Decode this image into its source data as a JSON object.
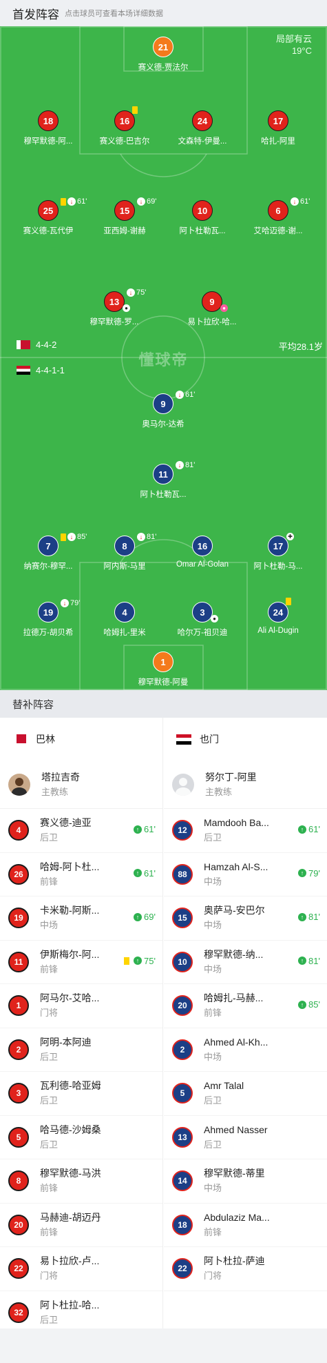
{
  "header": {
    "title": "首发阵容",
    "hint": "点击球员可查看本场详细数据"
  },
  "weather": {
    "condition": "局部有云",
    "temp": "19°C"
  },
  "watermark": "懂球帝",
  "home": {
    "formation": "4-4-2",
    "avg_age": "平均28.1岁",
    "players": [
      {
        "num": "21",
        "name": "赛义德-贾法尔",
        "gk": true
      },
      {
        "num": "18",
        "name": "穆罕默德-阿..."
      },
      {
        "num": "16",
        "name": "赛义德-巴吉尔",
        "card": true
      },
      {
        "num": "24",
        "name": "文森特-伊曼..."
      },
      {
        "num": "17",
        "name": "哈扎-阿里"
      },
      {
        "num": "25",
        "name": "赛义德-瓦代伊",
        "card": true,
        "subout": true,
        "minute": "61'"
      },
      {
        "num": "15",
        "name": "亚西姆-谢赫",
        "subout": true,
        "minute": "69'"
      },
      {
        "num": "10",
        "name": "阿卜杜勒瓦..."
      },
      {
        "num": "6",
        "name": "艾哈迈德-谢...",
        "subout": true,
        "minute": "61'"
      },
      {
        "num": "13",
        "name": "穆罕默德-罗...",
        "subout": true,
        "minute": "75'",
        "goal": true
      },
      {
        "num": "9",
        "name": "易卜拉欣-哈...",
        "owngoal": true
      }
    ]
  },
  "away": {
    "formation": "4-4-1-1",
    "players": [
      {
        "num": "9",
        "name": "奥马尔-达希",
        "subout": true,
        "minute": "61'"
      },
      {
        "num": "11",
        "name": "阿卜杜勒瓦...",
        "subout": true,
        "minute": "81'"
      },
      {
        "num": "7",
        "name": "纳赛尔-穆罕...",
        "card": true,
        "subout": true,
        "minute": "85'"
      },
      {
        "num": "8",
        "name": "阿内斯-马里",
        "subout": true,
        "minute": "81'"
      },
      {
        "num": "16",
        "name": "Omar Al-Golan"
      },
      {
        "num": "17",
        "name": "阿卜杜勒-马...",
        "injury": true
      },
      {
        "num": "19",
        "name": "拉德万-胡贝希",
        "subout": true,
        "minute": "79'"
      },
      {
        "num": "4",
        "name": "哈姆扎-里米"
      },
      {
        "num": "3",
        "name": "哈尔万-祖贝迪",
        "goal": true
      },
      {
        "num": "24",
        "name": "Ali Al-Dugin",
        "card": true
      },
      {
        "num": "1",
        "name": "穆罕默德-阿曼",
        "gk": true
      }
    ]
  },
  "subs_title": "替补阵容",
  "bench": {
    "left": {
      "team": "巴林",
      "coach": {
        "name": "塔拉吉奇",
        "role": "主教练"
      },
      "players": [
        {
          "num": "4",
          "name": "赛义德-迪亚",
          "pos": "后卫",
          "in": "61'"
        },
        {
          "num": "26",
          "name": "哈姆-阿卜杜...",
          "pos": "前锋",
          "in": "61'"
        },
        {
          "num": "19",
          "name": "卡米勒-阿斯...",
          "pos": "中场",
          "in": "69'"
        },
        {
          "num": "11",
          "name": "伊斯梅尔-阿...",
          "pos": "前锋",
          "in": "75'",
          "card": true
        },
        {
          "num": "1",
          "name": "阿马尔-艾哈...",
          "pos": "门将"
        },
        {
          "num": "2",
          "name": "阿明-本阿迪",
          "pos": "后卫"
        },
        {
          "num": "3",
          "name": "瓦利德-哈亚姆",
          "pos": "后卫"
        },
        {
          "num": "5",
          "name": "哈马德-沙姆桑",
          "pos": "后卫"
        },
        {
          "num": "8",
          "name": "穆罕默德-马洪",
          "pos": "前锋"
        },
        {
          "num": "20",
          "name": "马赫迪-胡迈丹",
          "pos": "前锋"
        },
        {
          "num": "22",
          "name": "易卜拉欣-卢...",
          "pos": "门将"
        },
        {
          "num": "32",
          "name": "阿卜杜拉-哈...",
          "pos": "后卫"
        }
      ]
    },
    "right": {
      "team": "也门",
      "coach": {
        "name": "努尔丁-阿里",
        "role": "主教练"
      },
      "players": [
        {
          "num": "12",
          "name": "Mamdooh Ba...",
          "pos": "后卫",
          "in": "61'"
        },
        {
          "num": "88",
          "name": "Hamzah Al-S...",
          "pos": "中场",
          "in": "79'"
        },
        {
          "num": "15",
          "name": "奥萨马-安巴尔",
          "pos": "中场",
          "in": "81'"
        },
        {
          "num": "10",
          "name": "穆罕默德-纳...",
          "pos": "中场",
          "in": "81'"
        },
        {
          "num": "20",
          "name": "哈姆扎-马赫...",
          "pos": "前锋",
          "in": "85'"
        },
        {
          "num": "2",
          "name": "Ahmed Al-Kh...",
          "pos": "中场"
        },
        {
          "num": "5",
          "name": "Amr Talal",
          "pos": "后卫"
        },
        {
          "num": "13",
          "name": "Ahmed Nasser",
          "pos": "后卫"
        },
        {
          "num": "14",
          "name": "穆罕默德-蒂里",
          "pos": "中场"
        },
        {
          "num": "18",
          "name": "Abdulaziz Ma...",
          "pos": "前锋"
        },
        {
          "num": "22",
          "name": "阿卜杜拉-萨迪",
          "pos": "门将"
        }
      ]
    }
  }
}
